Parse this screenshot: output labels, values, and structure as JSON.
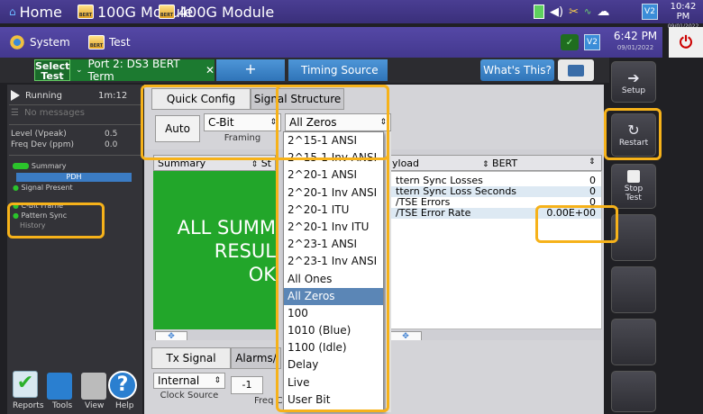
{
  "topbar": {
    "home_label": "Home",
    "module1_label": "100G Module",
    "module2_label": "400G Module",
    "chip_text": "BERT",
    "vbadge": "V2",
    "time": "10:42 PM",
    "date": "09/01/2022"
  },
  "secbar": {
    "system_label": "System",
    "test_label": "Test",
    "vbadge": "V2",
    "time": "6:42 PM",
    "date": "09/01/2022",
    "power_symbol": "⏻"
  },
  "tabs": {
    "select_test_line1": "Select",
    "select_test_line2": "Test",
    "port_tab": "Port 2: DS3 BERT Term",
    "plus_tab": "+",
    "timing_tab": "Timing Source",
    "whats_this": "What's This?"
  },
  "side_buttons": {
    "setup": "Setup",
    "restart": "Restart",
    "stop_line1": "Stop",
    "stop_line2": "Test"
  },
  "left_panel": {
    "status": "Running",
    "elapsed": "1m:12",
    "messages": "No messages",
    "level_label": "Level (Vpeak)",
    "level_value": "0.5",
    "freq_label": "Freq Dev (ppm)",
    "freq_value": "0.0",
    "tree": {
      "summary": "Summary",
      "pdh": "PDH",
      "signal_present": "Signal Present",
      "cbit_frame": "C-Bit Frame",
      "pattern_sync": "Pattern Sync",
      "history": "History"
    }
  },
  "config": {
    "tab_quick": "Quick Config",
    "tab_signal": "Signal Structure",
    "auto_btn": "Auto",
    "framing_value": "C-Bit",
    "framing_label": "Framing",
    "pattern_value": "All Zeros"
  },
  "summary_panel": {
    "header": "Summary",
    "header2": "St",
    "big_line1": "ALL SUMM",
    "big_line2": "RESUL",
    "big_line3": "OK"
  },
  "payload_panel": {
    "header_left": "yload",
    "header_right": "BERT",
    "rows": [
      {
        "label": "ttern Sync Losses",
        "value": "0"
      },
      {
        "label": "ttern Sync Loss Seconds",
        "value": "0"
      },
      {
        "label": "/TSE Errors",
        "value": "0"
      },
      {
        "label": "/TSE Error Rate",
        "value": "0.00E+00"
      }
    ]
  },
  "bottom": {
    "tx_tab": "Tx Signal",
    "alarms_tab": "Alarms/",
    "clock_value": "Internal",
    "clock_label": "Clock Source",
    "offset_value": "-1",
    "freq_label": "Freq C"
  },
  "dock": {
    "reports": "Reports",
    "tools": "Tools",
    "view": "View",
    "help": "Help"
  },
  "dropdown": {
    "items": [
      "2^15-1 ANSI",
      "2^15-1 Inv ANSI",
      "2^20-1 ANSI",
      "2^20-1 Inv ANSI",
      "2^20-1 ITU",
      "2^20-1 Inv ITU",
      "2^23-1 ANSI",
      "2^23-1 Inv ANSI",
      "All Ones",
      "All Zeros",
      "100",
      "1010 (Blue)",
      "1100 (Idle)",
      "Delay",
      "Live",
      "User Bit"
    ],
    "selected": "All Zeros"
  },
  "colors": {
    "highlight": "#f6b21a",
    "green_ok": "#22a62a",
    "selected_item": "#5b86b6",
    "top_bar": "#4a3e93"
  }
}
